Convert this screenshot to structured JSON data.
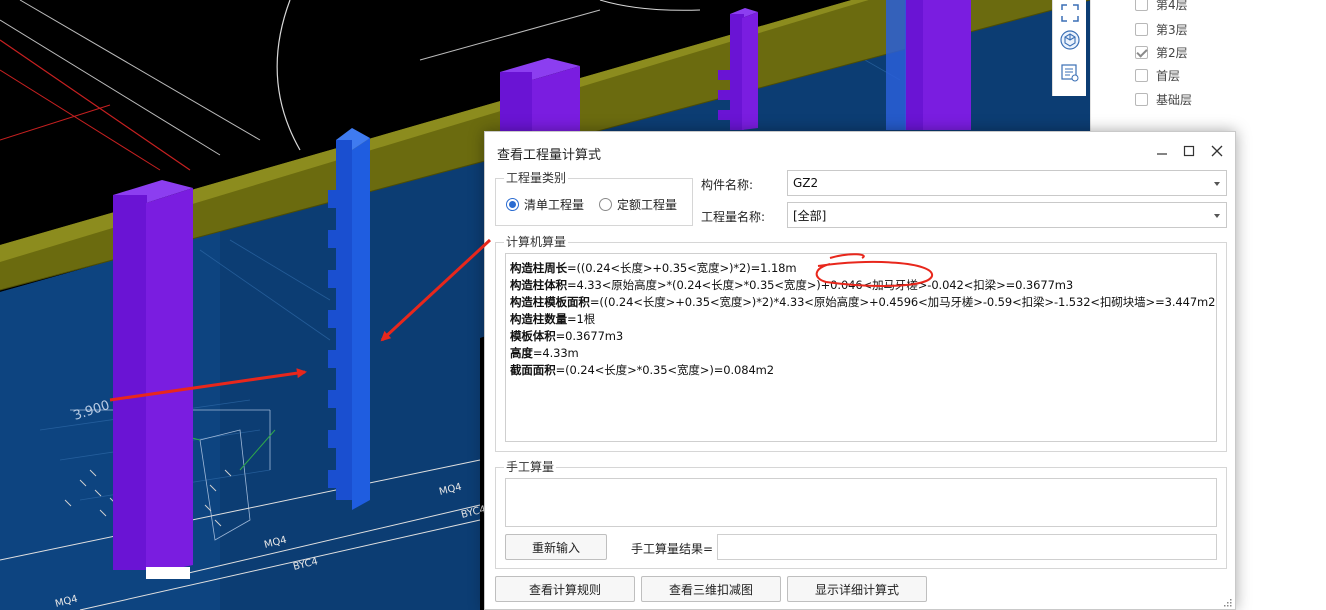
{
  "viewport": {
    "labels": {
      "mq4_a": "MQ4",
      "byc4_a": "BYC4",
      "mq4_b": "MQ4",
      "byc4_b": "BYC4",
      "mq4_c": "MQ4",
      "dim": "3.900"
    }
  },
  "floor_panel": {
    "floors": [
      {
        "label": "第4层",
        "checked": false
      },
      {
        "label": "第3层",
        "checked": false
      },
      {
        "label": "第2层",
        "checked": true
      },
      {
        "label": "首层",
        "checked": false
      },
      {
        "label": "基础层",
        "checked": false
      }
    ]
  },
  "dialog": {
    "title": "查看工程量计算式",
    "quantity_type": {
      "label": "工程量类别",
      "options": [
        "清单工程量",
        "定额工程量"
      ],
      "selected": 0
    },
    "component_name_label": "构件名称:",
    "component_name_value": "GZ2",
    "quantity_name_label": "工程量名称:",
    "quantity_name_value": "[全部]",
    "computer_calc": {
      "label": "计算机算量",
      "lines": [
        {
          "name": "构造柱周长",
          "expr": "=((0.24<长度>+0.35<宽度>)*2)=1.18m"
        },
        {
          "name": "构造柱体积",
          "expr": "=4.33<原始高度>*(0.24<长度>*0.35<宽度>)+0.046<加马牙槎>-0.042<扣梁>=0.3677m3"
        },
        {
          "name": "构造柱模板面积",
          "expr": "=((0.24<长度>+0.35<宽度>)*2)*4.33<原始高度>+0.4596<加马牙槎>-0.59<扣梁>-1.532<扣砌块墙>=3.447m2"
        },
        {
          "name": "构造柱数量",
          "expr": "=1根"
        },
        {
          "name": "模板体积",
          "expr": "=0.3677m3"
        },
        {
          "name": "高度",
          "expr": "=4.33m"
        },
        {
          "name": "截面面积",
          "expr": "=(0.24<长度>*0.35<宽度>)=0.084m2"
        }
      ]
    },
    "manual_calc": {
      "label": "手工算量",
      "reinput_button": "重新输入",
      "result_label": "手工算量结果="
    },
    "buttons": {
      "view_rules": "查看计算规则",
      "view_3d": "查看三维扣减图",
      "show_detail": "显示详细计算式"
    }
  },
  "colors": {
    "wall_blue": "#0c3d73",
    "beam_olive": "#6b6b0f",
    "column_purple": "#7a1de0",
    "column_blue": "#1f5de0",
    "annotation_red": "#e8271c",
    "radio_blue": "#2b6cd1"
  }
}
